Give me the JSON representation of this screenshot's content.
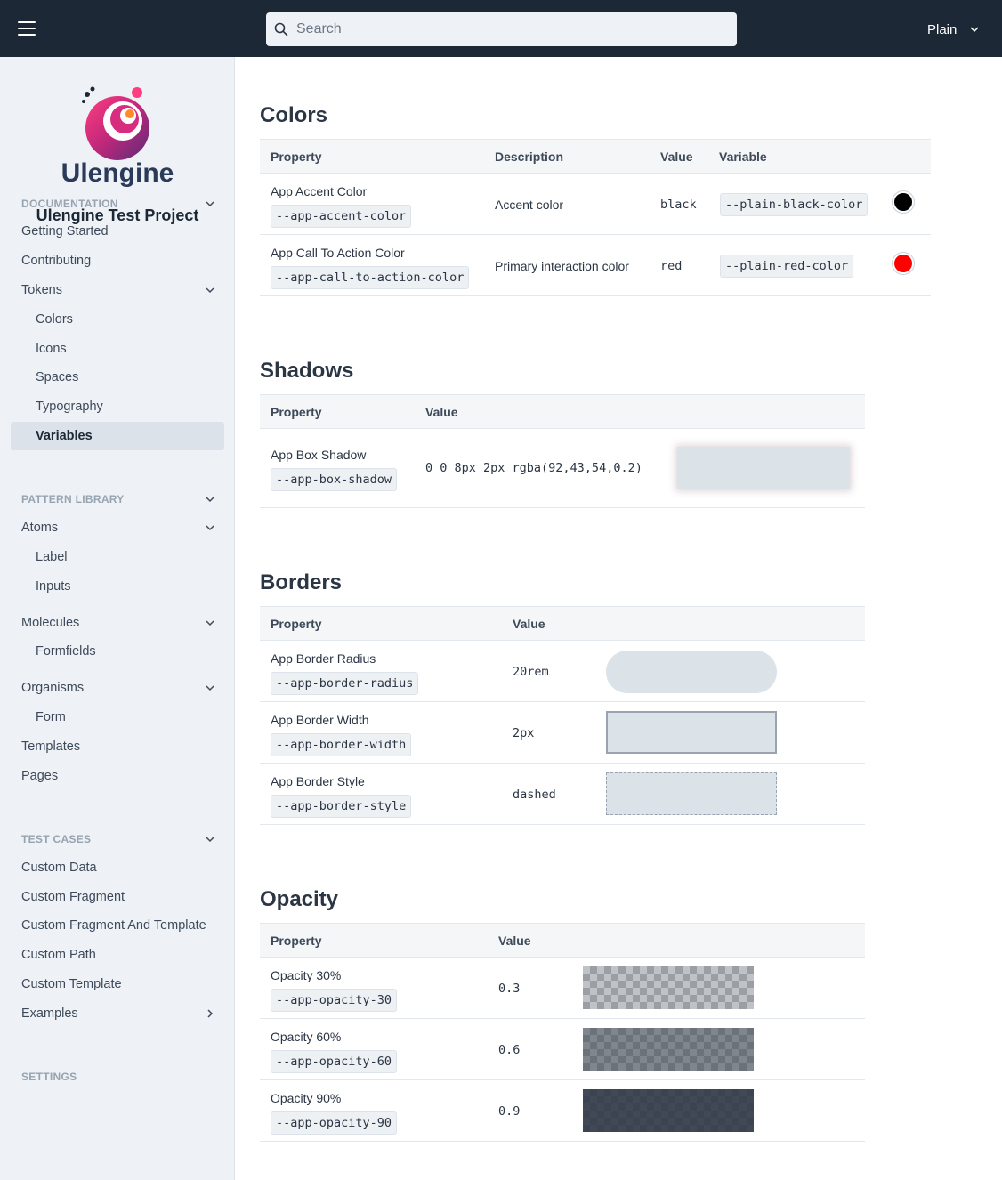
{
  "header": {
    "search_placeholder": "Search",
    "theme_label": "Plain"
  },
  "sidebar": {
    "project_title": "Ulengine Test Project",
    "items": [
      {
        "label": "DOCUMENTATION",
        "type": "section",
        "chevron": "down"
      },
      {
        "label": "Getting Started",
        "type": "item"
      },
      {
        "label": "Contributing",
        "type": "item"
      },
      {
        "label": "Tokens",
        "type": "item",
        "chevron": "down"
      },
      {
        "label": "Colors",
        "type": "sub"
      },
      {
        "label": "Icons",
        "type": "sub"
      },
      {
        "label": "Spaces",
        "type": "sub"
      },
      {
        "label": "Typography",
        "type": "sub"
      },
      {
        "label": "Variables",
        "type": "sub",
        "active": true
      },
      {
        "label": "PATTERN LIBRARY",
        "type": "section",
        "chevron": "down"
      },
      {
        "label": "Atoms",
        "type": "item",
        "chevron": "down"
      },
      {
        "label": "Label",
        "type": "sub"
      },
      {
        "label": "Inputs",
        "type": "sub"
      },
      {
        "label": "Molecules",
        "type": "item",
        "chevron": "down"
      },
      {
        "label": "Formfields",
        "type": "sub"
      },
      {
        "label": "Organisms",
        "type": "item",
        "chevron": "down"
      },
      {
        "label": "Form",
        "type": "sub"
      },
      {
        "label": "Templates",
        "type": "item"
      },
      {
        "label": "Pages",
        "type": "item"
      },
      {
        "label": "TEST CASES",
        "type": "section",
        "chevron": "down"
      },
      {
        "label": "Custom Data",
        "type": "item"
      },
      {
        "label": "Custom Fragment",
        "type": "item"
      },
      {
        "label": "Custom Fragment And Template",
        "type": "item"
      },
      {
        "label": "Custom Path",
        "type": "item"
      },
      {
        "label": "Custom Template",
        "type": "item"
      },
      {
        "label": "Examples",
        "type": "item",
        "chevron": "right"
      },
      {
        "label": "SETTINGS",
        "type": "section"
      }
    ]
  },
  "colors": {
    "title": "Colors",
    "headers": {
      "property": "Property",
      "description": "Description",
      "value": "Value",
      "variable": "Variable"
    },
    "rows": [
      {
        "name": "App Accent Color",
        "var": "--app-accent-color",
        "description": "Accent color",
        "value": "black",
        "variable": "--plain-black-color",
        "swatch": "#000000"
      },
      {
        "name": "App Call To Action Color",
        "var": "--app-call-to-action-color",
        "description": "Primary interaction color",
        "value": "red",
        "variable": "--plain-red-color",
        "swatch": "#ff0000"
      }
    ]
  },
  "shadows": {
    "title": "Shadows",
    "headers": {
      "property": "Property",
      "value": "Value"
    },
    "rows": [
      {
        "name": "App Box Shadow",
        "var": "--app-box-shadow",
        "value": "0 0 8px 2px rgba(92,43,54,0.2)"
      }
    ]
  },
  "borders": {
    "title": "Borders",
    "headers": {
      "property": "Property",
      "value": "Value"
    },
    "rows": [
      {
        "name": "App Border Radius",
        "var": "--app-border-radius",
        "value": "20rem"
      },
      {
        "name": "App Border Width",
        "var": "--app-border-width",
        "value": "2px"
      },
      {
        "name": "App Border Style",
        "var": "--app-border-style",
        "value": "dashed"
      }
    ]
  },
  "opacity": {
    "title": "Opacity",
    "headers": {
      "property": "Property",
      "value": "Value"
    },
    "rows": [
      {
        "name": "Opacity 30%",
        "var": "--app-opacity-30",
        "value": "0.3",
        "level": 0.3
      },
      {
        "name": "Opacity 60%",
        "var": "--app-opacity-60",
        "value": "0.6",
        "level": 0.6
      },
      {
        "name": "Opacity 90%",
        "var": "--app-opacity-90",
        "value": "0.9",
        "level": 0.9
      }
    ]
  }
}
